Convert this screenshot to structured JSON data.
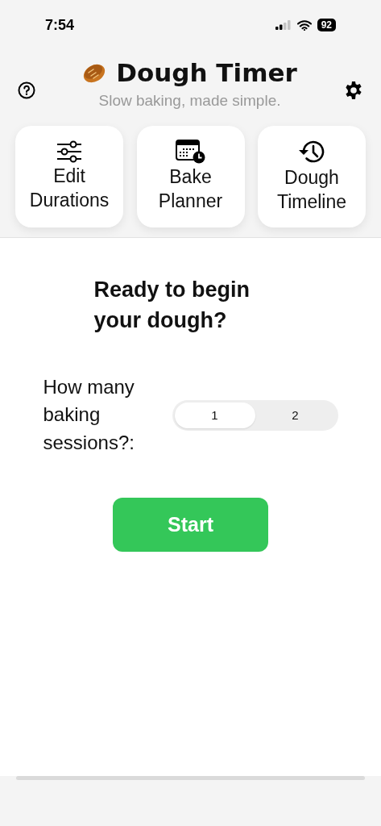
{
  "status_bar": {
    "time": "7:54",
    "battery": "92"
  },
  "header": {
    "title": "Dough Timer",
    "subtitle": "Slow baking, made simple."
  },
  "shortcuts": [
    {
      "kind": "sliders",
      "label": "Edit Durations"
    },
    {
      "kind": "calendar",
      "label": "Bake Planner"
    },
    {
      "kind": "history",
      "label": "Dough Timeline"
    }
  ],
  "main": {
    "heading": "Ready to begin your dough?",
    "question": "How many baking sessions?:",
    "sessions": [
      {
        "label": "1",
        "selected": true
      },
      {
        "label": "2",
        "selected": false
      }
    ],
    "start_button": "Start"
  }
}
